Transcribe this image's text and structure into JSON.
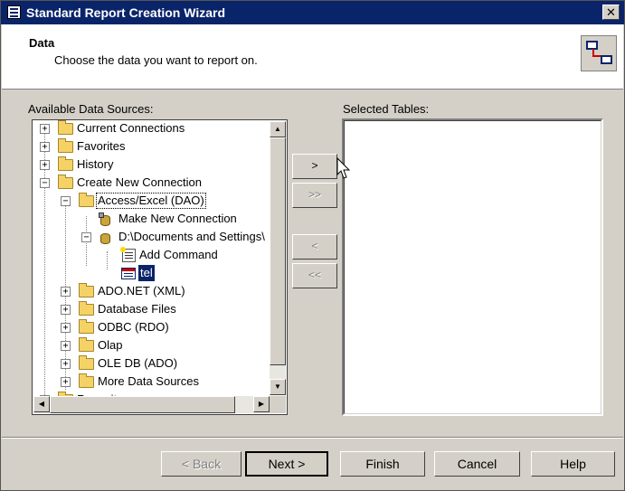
{
  "window": {
    "title": "Standard Report Creation Wizard",
    "close_glyph": "✕"
  },
  "header": {
    "title": "Data",
    "subtitle": "Choose the data you want to report on."
  },
  "labels": {
    "available": "Available Data Sources:",
    "selected": "Selected Tables:"
  },
  "tree": {
    "items": [
      {
        "label": "Current Connections",
        "expander": "+"
      },
      {
        "label": "Favorites",
        "expander": "+"
      },
      {
        "label": "History",
        "expander": "+"
      },
      {
        "label": "Create New Connection",
        "expander": "−"
      },
      {
        "label": "Access/Excel (DAO)",
        "expander": "−"
      },
      {
        "label": "Make New Connection"
      },
      {
        "label": "D:\\Documents and Settings\\",
        "expander": "−"
      },
      {
        "label": "Add Command"
      },
      {
        "label": "tel"
      },
      {
        "label": "ADO.NET (XML)",
        "expander": "+"
      },
      {
        "label": "Database Files",
        "expander": "+"
      },
      {
        "label": "ODBC (RDO)",
        "expander": "+"
      },
      {
        "label": "Olap",
        "expander": "+"
      },
      {
        "label": "OLE DB (ADO)",
        "expander": "+"
      },
      {
        "label": "More Data Sources",
        "expander": "+"
      },
      {
        "label": "Repository",
        "expander": "+"
      }
    ]
  },
  "scroll": {
    "up": "▲",
    "down": "▼",
    "left": "◀",
    "right": "▶"
  },
  "transfer": {
    "add": ">",
    "add_all": ">>",
    "remove": "<",
    "remove_all": "<<"
  },
  "footer": {
    "back": "< Back",
    "next": "Next >",
    "finish": "Finish",
    "cancel": "Cancel",
    "help": "Help"
  }
}
